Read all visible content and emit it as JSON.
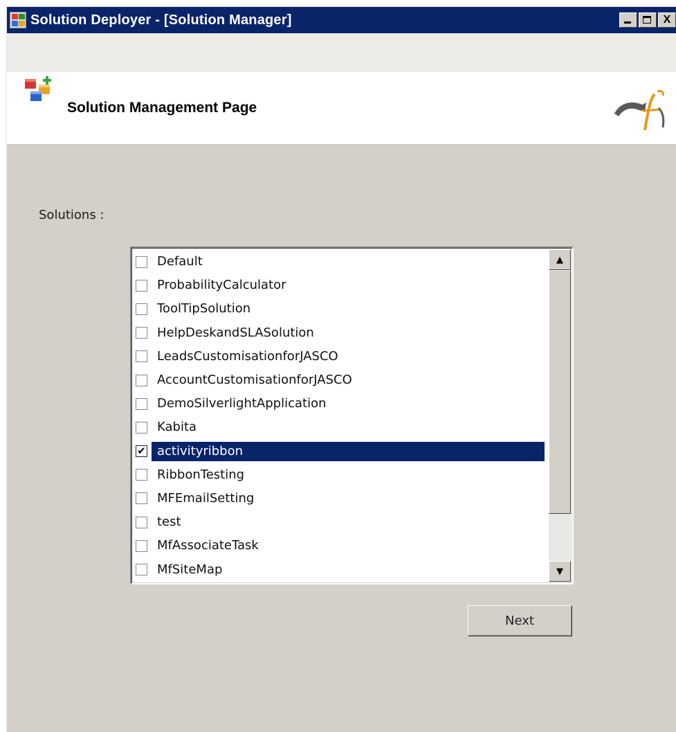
{
  "window": {
    "title": "Solution Deployer - [Solution Manager]"
  },
  "header": {
    "title": "Solution Management Page"
  },
  "solutions": {
    "label": "Solutions :",
    "items": [
      {
        "label": "Default",
        "checked": false,
        "selected": false
      },
      {
        "label": "ProbabilityCalculator",
        "checked": false,
        "selected": false
      },
      {
        "label": "ToolTipSolution",
        "checked": false,
        "selected": false
      },
      {
        "label": "HelpDeskandSLASolution",
        "checked": false,
        "selected": false
      },
      {
        "label": "LeadsCustomisationforJASCO",
        "checked": false,
        "selected": false
      },
      {
        "label": "AccountCustomisationforJASCO",
        "checked": false,
        "selected": false
      },
      {
        "label": "DemoSilverlightApplication",
        "checked": false,
        "selected": false
      },
      {
        "label": "Kabita",
        "checked": false,
        "selected": false
      },
      {
        "label": "activityribbon",
        "checked": true,
        "selected": true
      },
      {
        "label": "RibbonTesting",
        "checked": false,
        "selected": false
      },
      {
        "label": "MFEmailSetting",
        "checked": false,
        "selected": false
      },
      {
        "label": "test",
        "checked": false,
        "selected": false
      },
      {
        "label": "MfAssociateTask",
        "checked": false,
        "selected": false
      },
      {
        "label": "MfSiteMap",
        "checked": false,
        "selected": false
      }
    ]
  },
  "buttons": {
    "next_label": "Next"
  },
  "icons": {
    "app": "app-icon",
    "header": "colored-blocks-icon",
    "logo": "company-logo-icon",
    "check": "✔",
    "scroll_up": "▲",
    "scroll_down": "▼",
    "close": "X"
  },
  "colors": {
    "titlebar": "#0a246a",
    "selection": "#0a246a",
    "window_bg": "#d4d0c8"
  }
}
